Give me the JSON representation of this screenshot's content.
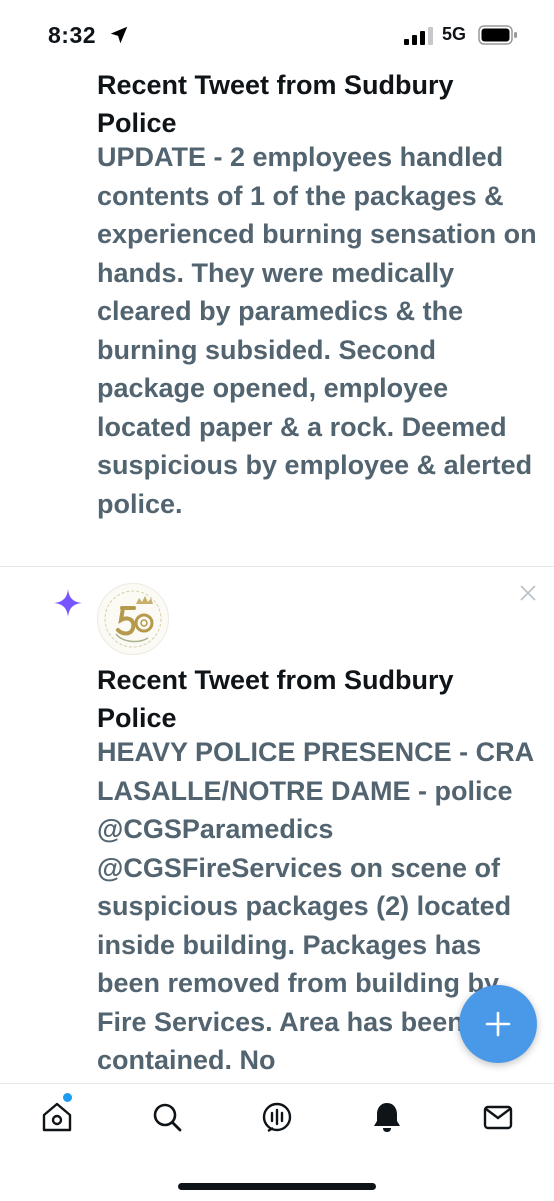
{
  "status_bar": {
    "time": "8:32",
    "network": "5G"
  },
  "tweets": [
    {
      "title": "Recent Tweet from Sudbury Police",
      "body": "UPDATE - 2 employees handled contents of 1 of the packages & experienced burning sensation on hands. They were medically cleared by paramedics & the burning subsided. Second package opened, employee located paper & a rock. Deemed suspicious by employee & alerted police."
    },
    {
      "title": "Recent Tweet from Sudbury Police",
      "body": "HEAVY POLICE PRESENCE - CRA LASALLE/NOTRE DAME - police @CGSParamedics @CGSFireServices on scene of suspicious packages (2) located inside building. Packages has been removed from building by Fire Services. Area has been contained. No"
    }
  ],
  "colors": {
    "accent": "#1d9bf0",
    "fab": "#4a99e9",
    "sparkle": "#7856ff",
    "body_text": "#536471",
    "title_text": "#0f1419"
  },
  "icons": {
    "fab": "plus-icon",
    "tabs": [
      "home-icon",
      "search-icon",
      "spaces-icon",
      "notifications-icon",
      "messages-icon"
    ]
  }
}
